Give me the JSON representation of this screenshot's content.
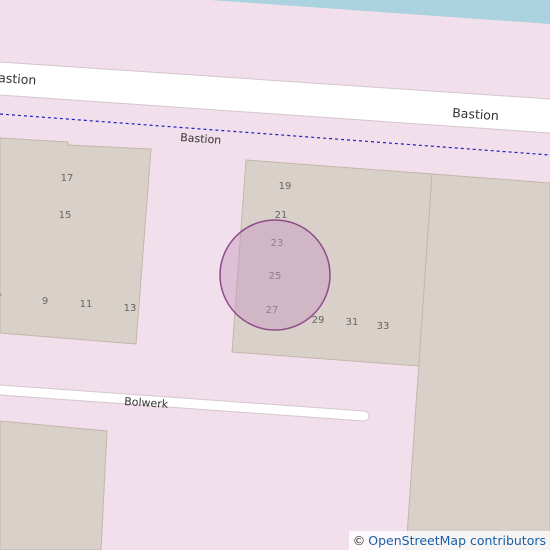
{
  "map": {
    "colors": {
      "background": "#f2dfec",
      "water": "#aad3df",
      "building": "#d9d0c9",
      "building_outline": "#c4b6ab",
      "road": "#ffffff",
      "road_casing": "#d4c6ce",
      "boundary": "#2020c0",
      "marker_fill": "#c896c0",
      "marker_stroke": "#8e4a8a"
    },
    "streets": [
      {
        "id": "bastion-west",
        "name": "astion"
      },
      {
        "id": "bastion-east",
        "name": "Bastion"
      },
      {
        "id": "bastion-center",
        "name": "Bastion"
      },
      {
        "id": "bolwerk",
        "name": "Bolwerk"
      }
    ],
    "house_numbers": [
      "17",
      "15",
      "9",
      "11",
      "13",
      "19",
      "21",
      "23",
      "25",
      "27",
      "29",
      "31",
      "33"
    ],
    "marker": {
      "type": "location-circle"
    }
  },
  "attribution": {
    "symbol": "©",
    "link_text": "OpenStreetMap contributors"
  }
}
